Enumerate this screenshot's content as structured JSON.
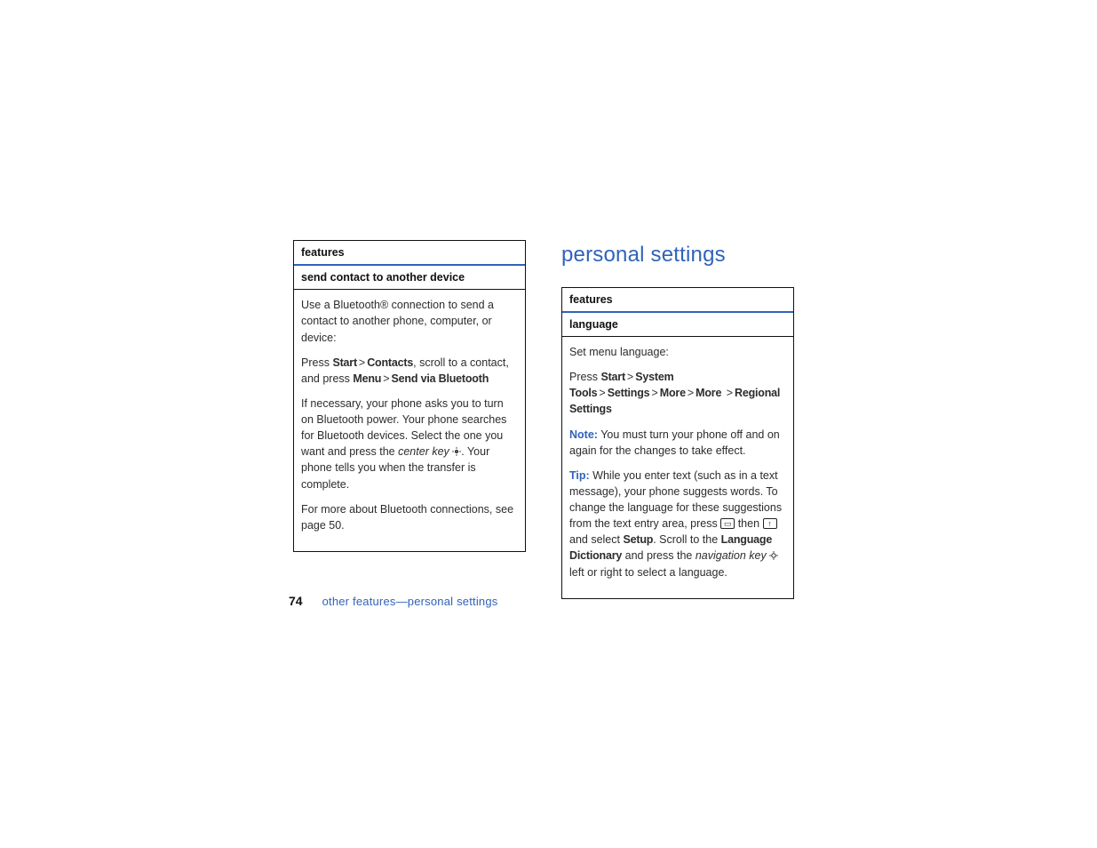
{
  "left": {
    "features_label": "features",
    "row_title": "send contact to another device",
    "p1": "Use a Bluetooth® connection to send a contact to another phone, computer, or device:",
    "p2_pre": "Press ",
    "p2_start": "Start",
    "p2_gt1": ">",
    "p2_contacts": "Contacts",
    "p2_mid": ", scroll to a contact, and press ",
    "p2_menu": "Menu",
    "p2_gt2": ">",
    "p2_send": "Send via Bluetooth",
    "p3_a": "If necessary, your phone asks you to turn on Bluetooth power. Your phone searches for Bluetooth devices. Select the one you want and press the ",
    "p3_key": "center key",
    "p3_b": ". Your phone tells you when the transfer is complete.",
    "p4": "For more about Bluetooth connections, see page 50."
  },
  "right": {
    "heading": "personal settings",
    "features_label": "features",
    "row_title": "language",
    "p1": "Set menu language:",
    "p2_pre": "Press ",
    "p2_start": "Start",
    "p2_gt": ">",
    "p2_systools": "System Tools",
    "p2_settings": "Settings",
    "p2_more": "More",
    "p2_regional": "Regional Settings",
    "note_label": "Note:",
    "note_text": " You must turn your phone off and on again for the changes to take effect.",
    "tip_label": "Tip:",
    "tip_a": " While you enter text (such as in a text message), your phone suggests words. To change the language for these suggestions from the text entry area, press ",
    "tip_then": " then ",
    "tip_b": " and select ",
    "tip_setup": "Setup",
    "tip_c": ". Scroll to the ",
    "tip_langdict": "Language Dictionary",
    "tip_d": " and press the ",
    "tip_navkey": "navigation key",
    "tip_e": " left or right to select a language."
  },
  "footer": {
    "page": "74",
    "path": "other features—personal settings"
  }
}
